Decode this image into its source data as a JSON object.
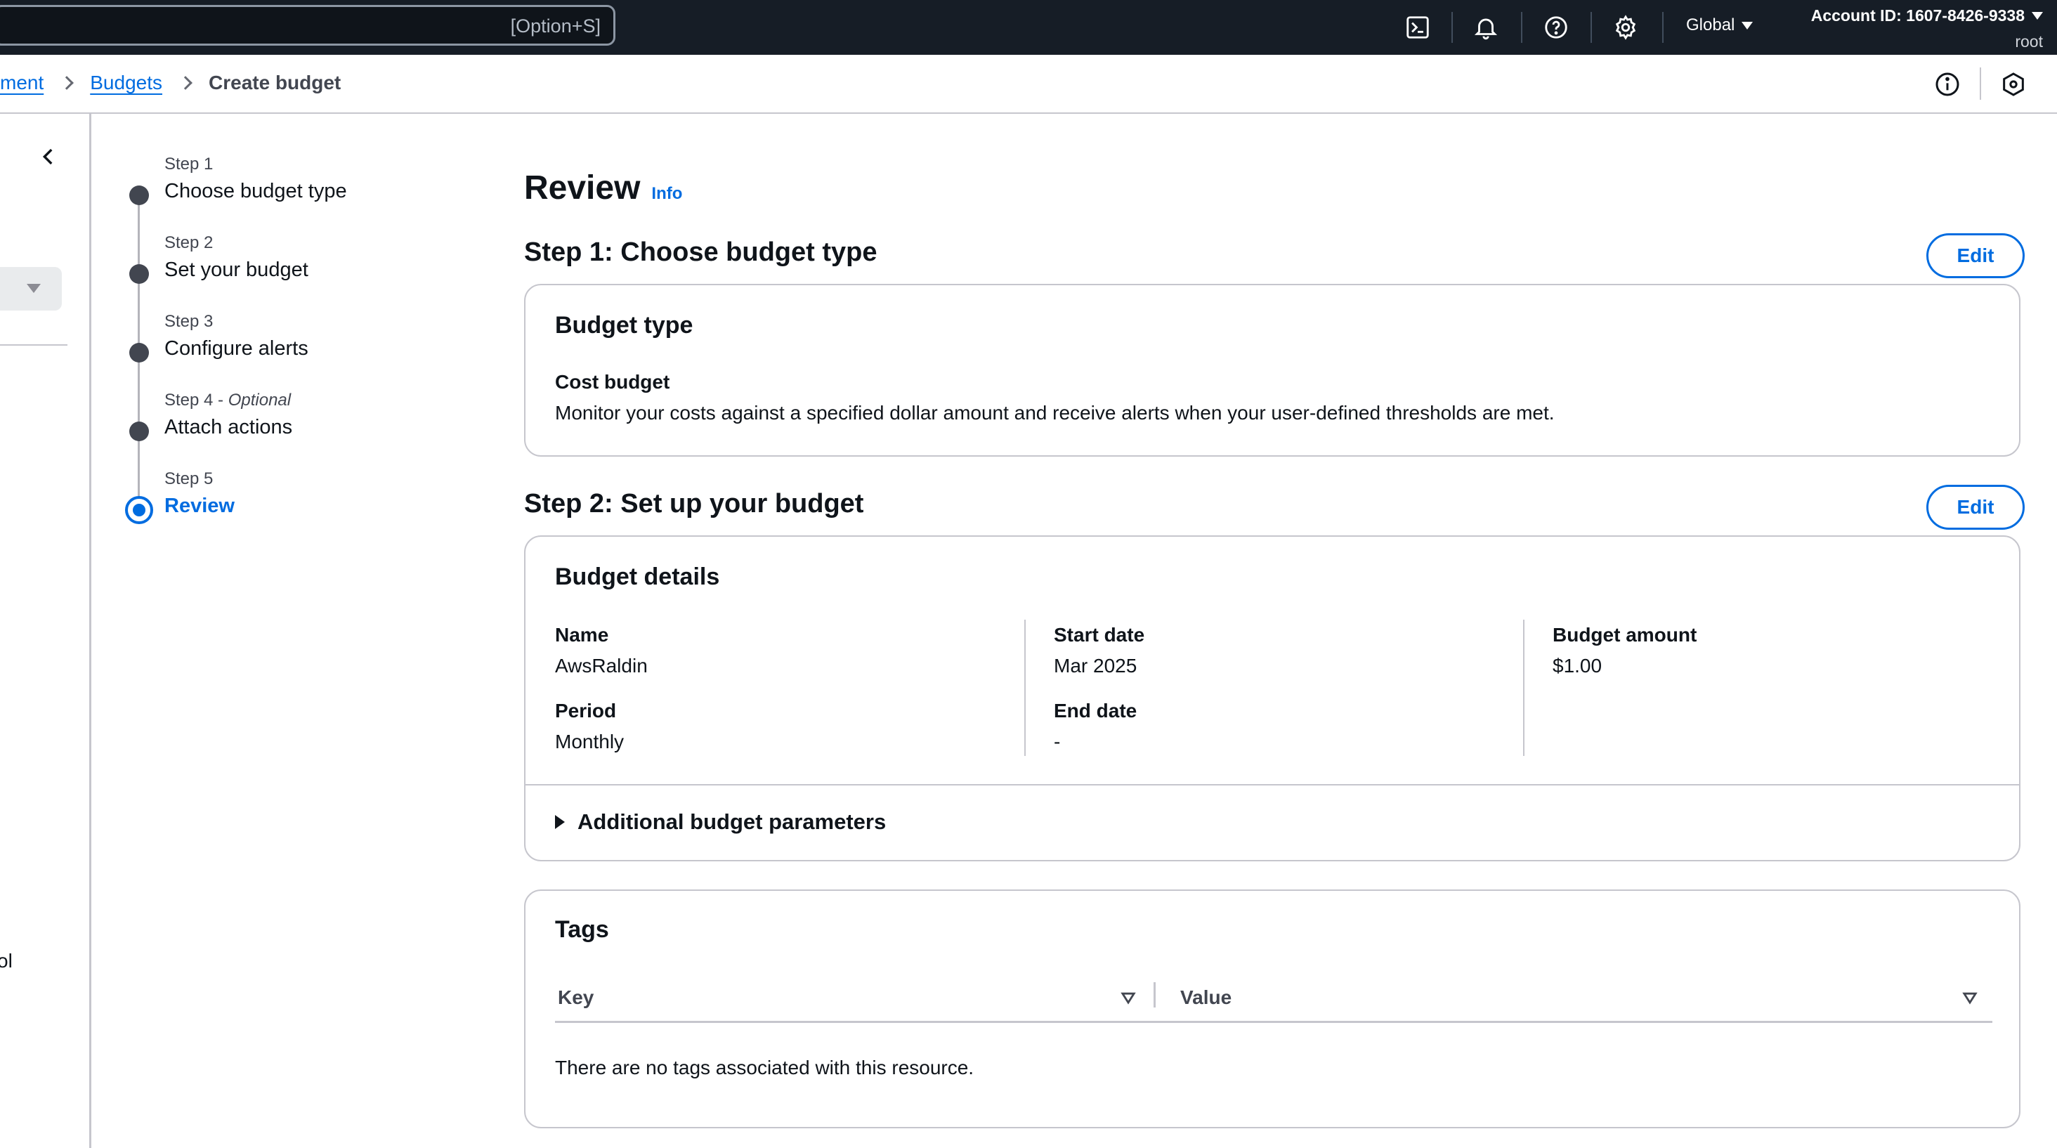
{
  "topnav": {
    "search_shortcut": "[Option+S]",
    "region": "Global",
    "account_id": "Account ID: 1607-8426-9338",
    "user": "root",
    "icons": [
      "cloudshell-icon",
      "bell-icon",
      "help-icon",
      "settings-icon"
    ]
  },
  "breadcrumb": {
    "items": [
      "ment",
      "Budgets"
    ],
    "current": "Create budget"
  },
  "leftnav": {
    "partial_text": "ol"
  },
  "steps": [
    {
      "label": "Step 1",
      "optional": "",
      "title": "Choose budget type",
      "state": "complete"
    },
    {
      "label": "Step 2",
      "optional": "",
      "title": "Set your budget",
      "state": "complete"
    },
    {
      "label": "Step 3",
      "optional": "",
      "title": "Configure alerts",
      "state": "complete"
    },
    {
      "label": "Step 4 - ",
      "optional": "Optional",
      "title": "Attach actions",
      "state": "complete"
    },
    {
      "label": "Step 5",
      "optional": "",
      "title": "Review",
      "state": "current"
    }
  ],
  "page": {
    "title": "Review",
    "info": "Info",
    "edit_label": "Edit"
  },
  "section1": {
    "heading": "Step 1: Choose budget type",
    "card_title": "Budget type",
    "type_name": "Cost budget",
    "type_desc": "Monitor your costs against a specified dollar amount and receive alerts when your user-defined thresholds are met."
  },
  "section2": {
    "heading": "Step 2: Set up your budget",
    "card_title": "Budget details",
    "name_label": "Name",
    "name_value": "AwsRaldin",
    "period_label": "Period",
    "period_value": "Monthly",
    "start_label": "Start date",
    "start_value": "Mar 2025",
    "end_label": "End date",
    "end_value": "-",
    "amount_label": "Budget amount",
    "amount_value": "$1.00",
    "additional": "Additional budget parameters"
  },
  "tags": {
    "title": "Tags",
    "columns": [
      "Key",
      "Value"
    ],
    "empty": "There are no tags associated with this resource."
  },
  "colors": {
    "nav_bg": "#161d26",
    "link": "#006ce0",
    "border": "#c6c6cd"
  }
}
